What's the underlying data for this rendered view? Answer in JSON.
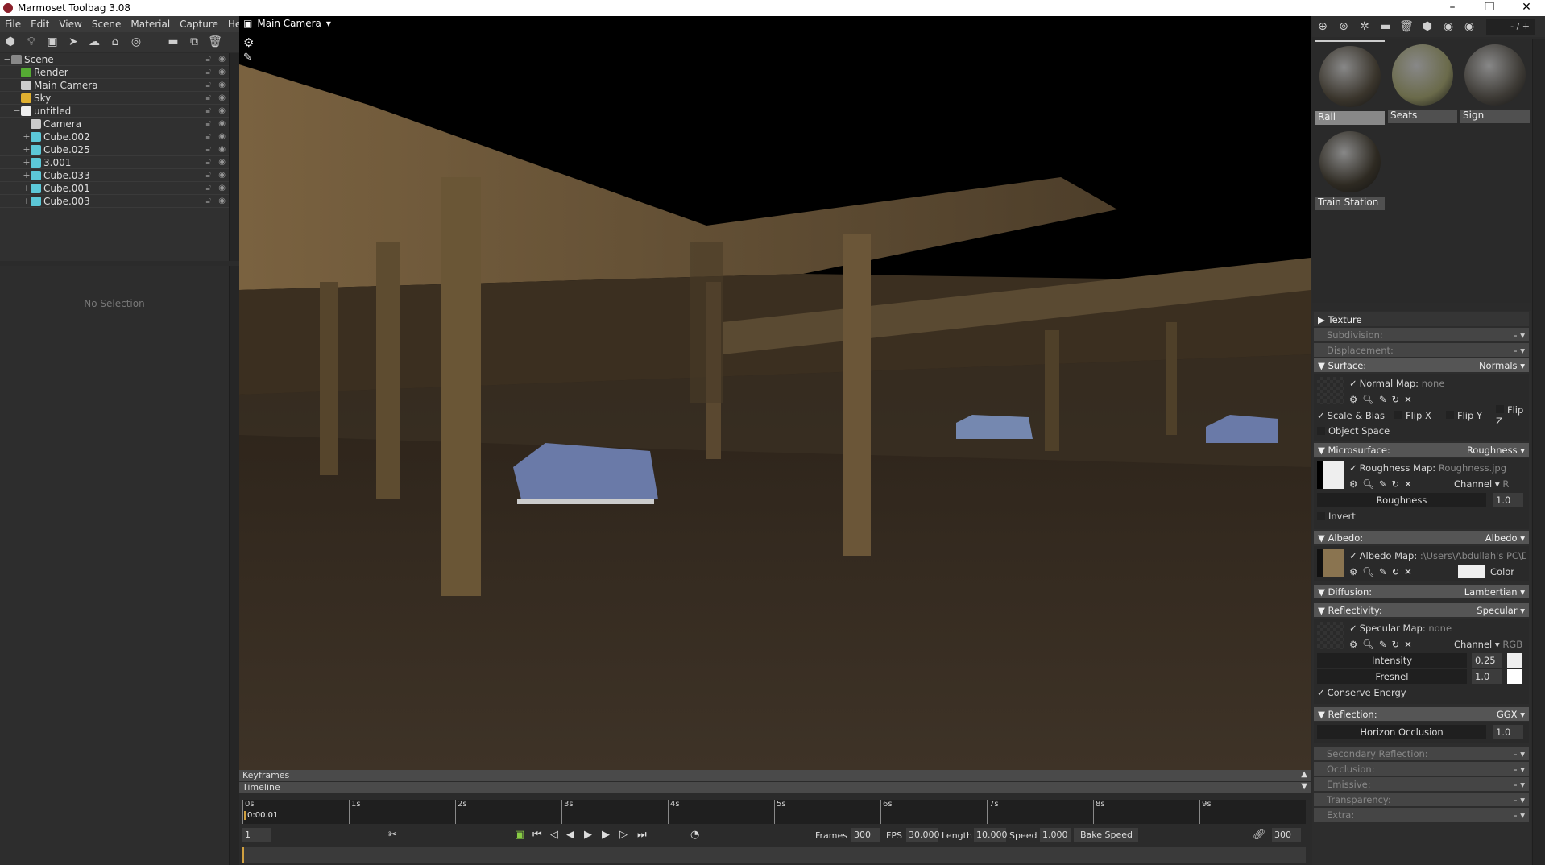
{
  "window": {
    "title": "Marmoset Toolbag 3.08",
    "controls": [
      "–",
      "❐",
      "✕"
    ]
  },
  "menu": [
    "File",
    "Edit",
    "View",
    "Scene",
    "Material",
    "Capture",
    "Help"
  ],
  "scene_tree": [
    {
      "label": "Scene",
      "icon": "scene-icon",
      "level": 0
    },
    {
      "label": "Render",
      "icon": "render-icon",
      "level": 1
    },
    {
      "label": "Main Camera",
      "icon": "camera-icon",
      "level": 1
    },
    {
      "label": "Sky",
      "icon": "sky-icon",
      "level": 1
    },
    {
      "label": "untitled",
      "icon": "group-icon",
      "level": 1
    },
    {
      "label": "Camera",
      "icon": "camera-icon",
      "level": 2
    },
    {
      "label": "Cube.002",
      "icon": "mesh-icon",
      "level": 2
    },
    {
      "label": "Cube.025",
      "icon": "mesh-icon",
      "level": 2
    },
    {
      "label": "3.001",
      "icon": "mesh-icon",
      "level": 2
    },
    {
      "label": "Cube.033",
      "icon": "mesh-icon",
      "level": 2
    },
    {
      "label": "Cube.001",
      "icon": "mesh-icon",
      "level": 2
    },
    {
      "label": "Cube.003",
      "icon": "mesh-icon",
      "level": 2
    }
  ],
  "properties": {
    "empty_text": "No Selection"
  },
  "viewport": {
    "camera_label": "Main Camera"
  },
  "timeline": {
    "keyframes_label": "Keyframes",
    "timeline_label": "Timeline",
    "ticks": [
      "0s",
      "1s",
      "2s",
      "3s",
      "4s",
      "5s",
      "6s",
      "7s",
      "8s",
      "9s"
    ],
    "current_time": "0:00.01",
    "frame_field": "1",
    "frames_label": "Frames",
    "frames": "300",
    "fps_label": "FPS",
    "fps": "30.000",
    "length_label": "Length",
    "length": "10.000",
    "speed_label": "Speed",
    "speed": "1.000",
    "bake_speed": "Bake Speed",
    "end_frame": "300",
    "playhead_fraction": 0.0
  },
  "materials": {
    "counter": "- / +",
    "items": [
      {
        "name": "Rail",
        "selected": true,
        "color": "#3a352c"
      },
      {
        "name": "Seats",
        "selected": false,
        "color": "#6a6a4a"
      },
      {
        "name": "Sign",
        "selected": false,
        "color": "#3d3a35"
      },
      {
        "name": "Train Station",
        "selected": false,
        "color": "#2e2a22"
      }
    ]
  },
  "material_editor": {
    "texture": "Texture",
    "subdivision": {
      "label": "Subdivision:",
      "value": "-"
    },
    "displacement": {
      "label": "Displacement:",
      "value": "-"
    },
    "surface": {
      "label": "Surface:",
      "value": "Normals",
      "map_label": "Normal Map:",
      "map": "none",
      "scale_bias": "Scale & Bias",
      "flip_x": "Flip X",
      "flip_y": "Flip Y",
      "flip_z": "Flip Z",
      "object_space": "Object Space"
    },
    "microsurface": {
      "label": "Microsurface:",
      "value": "Roughness",
      "map_label": "Roughness Map:",
      "map": "Roughness.jpg",
      "channel_label": "Channel",
      "channel": "R",
      "slider_label": "Roughness",
      "slider_value": "1.0",
      "invert": "Invert"
    },
    "albedo": {
      "label": "Albedo:",
      "value": "Albedo",
      "map_label": "Albedo Map:",
      "map": ":\\Users\\Abdullah's PC\\Desk",
      "color_label": "Color"
    },
    "diffusion": {
      "label": "Diffusion:",
      "value": "Lambertian"
    },
    "reflectivity": {
      "label": "Reflectivity:",
      "value": "Specular",
      "map_label": "Specular Map:",
      "map": "none",
      "channel_label": "Channel",
      "channel": "RGB",
      "intensity_label": "Intensity",
      "intensity": "0.25",
      "fresnel_label": "Fresnel",
      "fresnel": "1.0",
      "conserve": "Conserve Energy"
    },
    "reflection": {
      "label": "Reflection:",
      "value": "GGX",
      "horizon_label": "Horizon Occlusion",
      "horizon": "1.0"
    },
    "secondary": {
      "label": "Secondary Reflection:",
      "value": "-"
    },
    "occlusion": {
      "label": "Occlusion:",
      "value": "-"
    },
    "emissive": {
      "label": "Emissive:",
      "value": "-"
    },
    "transparency": {
      "label": "Transparency:",
      "value": "-"
    },
    "extra": {
      "label": "Extra:",
      "value": "-"
    }
  }
}
